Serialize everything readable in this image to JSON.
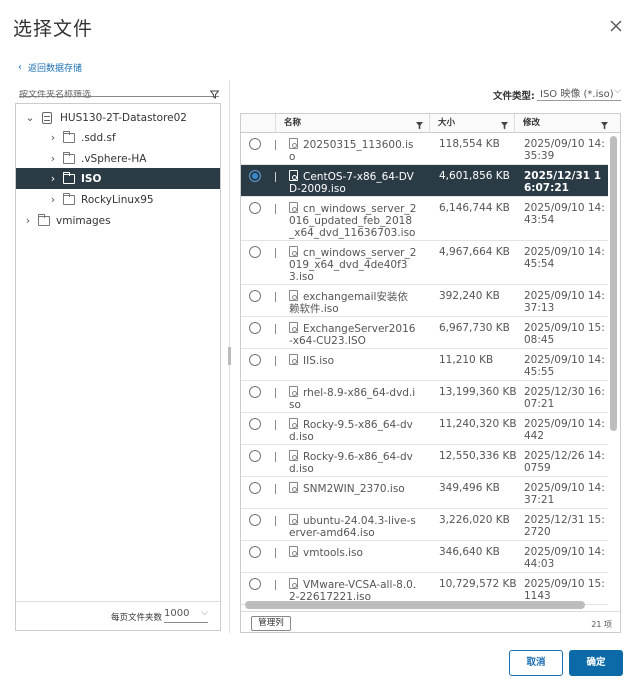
{
  "dialog": {
    "title": "选择文件",
    "back_label": "返回数据存储"
  },
  "tree": {
    "filter_placeholder": "按文件夹名称筛选",
    "items": [
      {
        "label": "HUS130-2T-Datastore02",
        "icon": "datastore-icon",
        "expanded": true
      },
      {
        "label": ".sdd.sf",
        "icon": "folder-icon"
      },
      {
        "label": ".vSphere-HA",
        "icon": "folder-icon"
      },
      {
        "label": "ISO",
        "icon": "folder-icon",
        "selected": true
      },
      {
        "label": "RockyLinux95",
        "icon": "folder-icon"
      },
      {
        "label": "vmimages",
        "icon": "folder-icon"
      }
    ],
    "per_page_label": "每页文件夹数",
    "per_page_value": "1000"
  },
  "file_type": {
    "label": "文件类型:",
    "value": "ISO 映像 (*.iso)"
  },
  "grid": {
    "columns": [
      "名称",
      "大小",
      "修改"
    ],
    "rows": [
      {
        "name": "20250315_113600.iso",
        "size": "118,554 KB",
        "modified": "2025/09/10 14:35:39"
      },
      {
        "name": "CentOS-7-x86_64-DVD-2009.iso",
        "size": "4,601,856 KB",
        "modified": "2025/12/31 16:07:21",
        "selected": true
      },
      {
        "name": "cn_windows_server_2016_updated_feb_2018_x64_dvd_11636703.iso",
        "size": "6,146,744 KB",
        "modified": "2025/09/10 14:43:54"
      },
      {
        "name": "cn_windows_server_2019_x64_dvd_4de40f33.iso",
        "size": "4,967,664 KB",
        "modified": "2025/09/10 14:45:54"
      },
      {
        "name": "exchangemail安装依赖软件.iso",
        "size": "392,240 KB",
        "modified": "2025/09/10 14:37:13"
      },
      {
        "name": "ExchangeServer2016-x64-CU23.ISO",
        "size": "6,967,730 KB",
        "modified": "2025/09/10 15:08:45"
      },
      {
        "name": "IIS.iso",
        "size": "11,210 KB",
        "modified": "2025/09/10 14:45:55"
      },
      {
        "name": "rhel-8.9-x86_64-dvd.iso",
        "size": "13,199,360 KB",
        "modified": "2025/12/30 16:07:21"
      },
      {
        "name": "Rocky-9.5-x86_64-dvd.iso",
        "size": "11,240,320 KB",
        "modified": "2025/09/10 14:442"
      },
      {
        "name": "Rocky-9.6-x86_64-dvd.iso",
        "size": "12,550,336 KB",
        "modified": "2025/12/26 14:0759"
      },
      {
        "name": "SNM2WIN_2370.iso",
        "size": "349,496 KB",
        "modified": "2025/09/10 14:37:21"
      },
      {
        "name": "ubuntu-24.04.3-live-server-amd64.iso",
        "size": "3,226,020 KB",
        "modified": "2025/12/31 15:2720"
      },
      {
        "name": "vmtools.iso",
        "size": "346,640 KB",
        "modified": "2025/09/10 14:44:03"
      },
      {
        "name": "VMware-VCSA-all-8.0.2-22617221.iso",
        "size": "10,729,572 KB",
        "modified": "2025/09/10 15:1143"
      }
    ],
    "manage_columns_label": "管理列",
    "item_count": "21 项"
  },
  "actions": {
    "cancel_label": "取消",
    "ok_label": "确定"
  }
}
